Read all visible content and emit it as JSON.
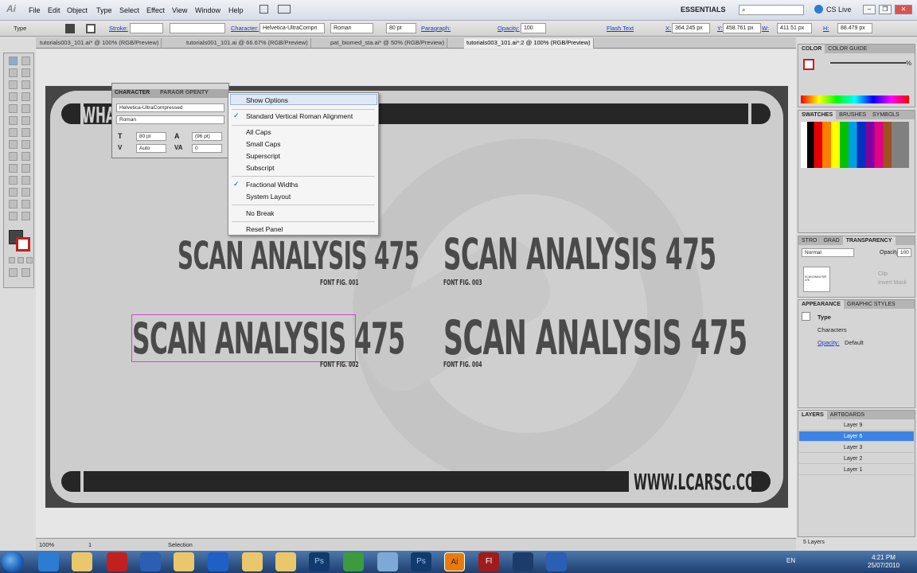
{
  "menubar": {
    "app_logo": "Ai",
    "items": [
      "File",
      "Edit",
      "Object",
      "Type",
      "Select",
      "Effect",
      "View",
      "Window",
      "Help"
    ],
    "workspace": "ESSENTIALS",
    "cs_live": "CS Live"
  },
  "control": {
    "tool_label": "Type",
    "stroke_label": "Stroke:",
    "character_label": "Character:",
    "font": "Helvetica-UltraCompn",
    "style": "Roman",
    "size": "80 pt",
    "paragraph_label": "Paragraph:",
    "opacity_label": "Opacity:",
    "opacity": "100",
    "flash_text": "Flash Text",
    "x_label": "X:",
    "x": "364.245 px",
    "y_label": "Y:",
    "y": "458.761 px",
    "w_label": "W:",
    "w": "411.51 px",
    "h_label": "H:",
    "h": "88.479 px"
  },
  "tabs": [
    "tutorials003_101.ai* @ 100% (RGB/Preview)",
    "tutorials001_101.ai @ 66.67% (RGB/Preview)",
    "pat_biomed_sta.ai* @ 50% (RGB/Preview)",
    "tutorials003_101.ai*:2 @ 100% (RGB/Preview)"
  ],
  "artwork": {
    "top_text": "WHA",
    "headings": [
      {
        "text": "SCAN ANALYSIS 475",
        "sub": "FONT FIG. 001"
      },
      {
        "text": "SCAN ANALYSIS 475",
        "sub": "FONT FIG. 002"
      },
      {
        "text": "SCAN ANALYSIS 475",
        "sub": "FONT FIG. 003"
      },
      {
        "text": "SCAN ANALYSIS 475",
        "sub": "FONT FIG. 004"
      }
    ],
    "url": "WWW.LCARSC.COM"
  },
  "character_panel": {
    "tabs": [
      "CHARACTER",
      "PARAGR",
      "OPENTY"
    ],
    "font": "Helvetica-UltraCompressed",
    "style": "Roman",
    "size": "80 pt",
    "leading": "(96 pt)",
    "kerning": "Auto",
    "tracking": "0"
  },
  "flyout": {
    "items": [
      {
        "label": "Show Options",
        "checked": false
      },
      {
        "label": "Standard Vertical Roman Alignment",
        "checked": true
      },
      {
        "label": "All Caps",
        "checked": false
      },
      {
        "label": "Small Caps",
        "checked": false
      },
      {
        "label": "Superscript",
        "checked": false
      },
      {
        "label": "Subscript",
        "checked": false
      },
      {
        "label": "Fractional Widths",
        "checked": true
      },
      {
        "label": "System Layout",
        "checked": false
      },
      {
        "label": "No Break",
        "checked": false
      },
      {
        "label": "Reset Panel",
        "checked": false
      }
    ],
    "check_glyph": "✓"
  },
  "color_panel": {
    "tabs": [
      "COLOR",
      "COLOR GUIDE"
    ],
    "percent": "%"
  },
  "swatches_panel": {
    "tabs": [
      "SWATCHES",
      "BRUSHES",
      "SYMBOLS"
    ]
  },
  "transparency_panel": {
    "tabs": [
      "STRO",
      "GRAD",
      "TRANSPARENCY"
    ],
    "blend": "Normal",
    "opacity_label": "Opacity:",
    "opacity": "100",
    "clip": "Clip",
    "invert_mask": "Invert Mask",
    "thumb_text": "SCAN ANALYSIS 475"
  },
  "appearance_panel": {
    "tabs": [
      "APPEARANCE",
      "GRAPHIC STYLES"
    ],
    "type": "Type",
    "characters": "Characters",
    "opacity_label": "Opacity:",
    "opacity_value": "Default"
  },
  "layers_panel": {
    "tabs": [
      "LAYERS",
      "ARTBOARDS"
    ],
    "layers": [
      "Layer 9",
      "Layer 6",
      "Layer 3",
      "Layer 2",
      "Layer 1"
    ],
    "selected": "Layer 6",
    "count": "5 Layers"
  },
  "status": {
    "zoom": "100%",
    "artboard": "1",
    "tool": "Selection"
  },
  "taskbar": {
    "lang": "EN",
    "time": "4:21 PM",
    "date": "25/07/2010",
    "apps": [
      "ie",
      "explorer",
      "filezilla",
      "word",
      "folder",
      "firefox",
      "folder2",
      "notepad",
      "photoshop",
      "network",
      "photoshop2",
      "illustrator",
      "flash",
      "app1",
      "app2"
    ]
  }
}
